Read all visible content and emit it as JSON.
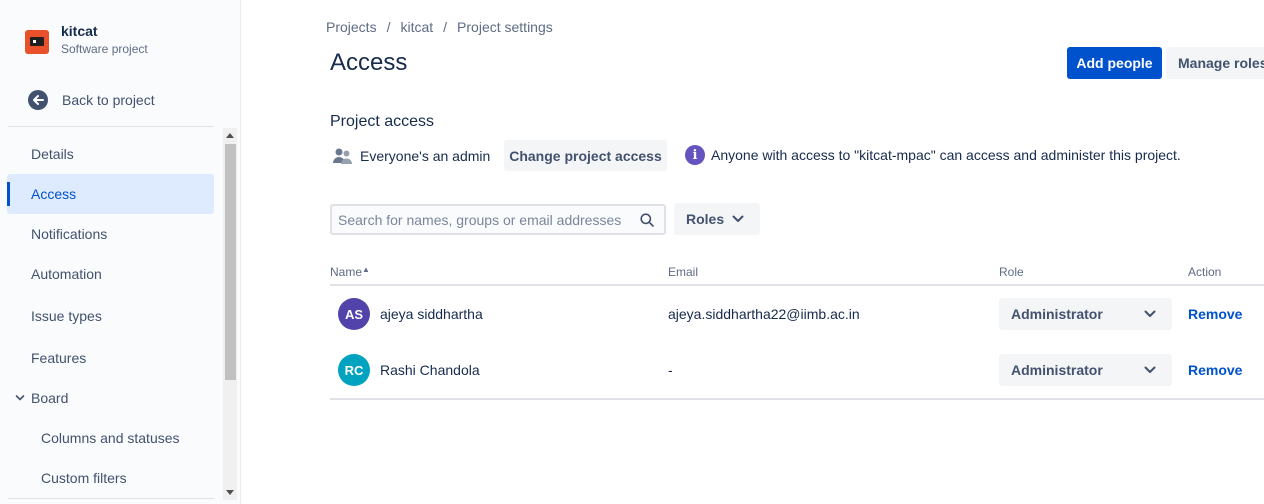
{
  "project": {
    "name": "kitcat",
    "type": "Software project"
  },
  "sidebar": {
    "back_label": "Back to project",
    "items": [
      {
        "label": "Details"
      },
      {
        "label": "Access",
        "active": true
      },
      {
        "label": "Notifications"
      },
      {
        "label": "Automation"
      },
      {
        "label": "Issue types"
      },
      {
        "label": "Features"
      },
      {
        "label": "Board",
        "expanded": true
      },
      {
        "label": "Columns and statuses"
      },
      {
        "label": "Custom filters"
      }
    ]
  },
  "breadcrumb": [
    "Projects",
    "kitcat",
    "Project settings"
  ],
  "page_title": "Access",
  "buttons": {
    "add_people": "Add people",
    "manage_roles": "Manage roles",
    "change_access": "Change project access",
    "roles_filter": "Roles"
  },
  "project_access": {
    "title": "Project access",
    "status": "Everyone's an admin",
    "info": "Anyone with access to \"kitcat-mpac\" can access and administer this project."
  },
  "search": {
    "placeholder": "Search for names, groups or email addresses",
    "value": ""
  },
  "table": {
    "headers": {
      "name": "Name",
      "email": "Email",
      "role": "Role",
      "action": "Action"
    },
    "rows": [
      {
        "initials": "AS",
        "name": "ajeya siddhartha",
        "email": "ajeya.siddhartha22@iimb.ac.in",
        "role": "Administrator",
        "action": "Remove",
        "avatar_color": "#5243aa"
      },
      {
        "initials": "RC",
        "name": "Rashi Chandola",
        "email": "-",
        "role": "Administrator",
        "action": "Remove",
        "avatar_color": "#00a3bf"
      }
    ]
  },
  "colors": {
    "accent": "#0052cc",
    "info": "#6554c0",
    "project_icon": "#e8512a"
  }
}
